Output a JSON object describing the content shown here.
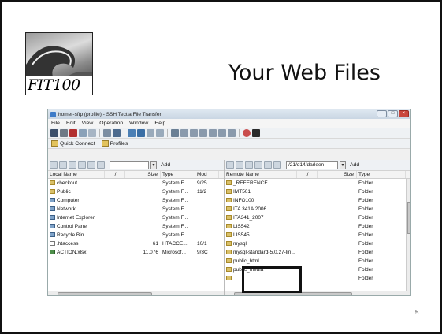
{
  "slide": {
    "title": "Your Web Files",
    "logo_text": "FIT100",
    "page_number": "5"
  },
  "window": {
    "title": "homer-sftp (profile) - SSH Tectia File Transfer",
    "menu": [
      "File",
      "Edit",
      "View",
      "Operation",
      "Window",
      "Help"
    ],
    "quick_connect": "Quick Connect",
    "profiles": "Profiles"
  },
  "left_pane": {
    "path": "",
    "add_label": "Add",
    "columns": [
      "Local Name",
      "/",
      "Size",
      "Type",
      "Mod"
    ],
    "rows": [
      {
        "name": "checkout",
        "size": "",
        "type": "System F...",
        "mod": "9/25",
        "icon": "folder-icon"
      },
      {
        "name": "Public",
        "size": "",
        "type": "System F...",
        "mod": "11/2",
        "icon": "folder-icon"
      },
      {
        "name": "Computer",
        "size": "",
        "type": "System F...",
        "mod": "",
        "icon": "computer-icon"
      },
      {
        "name": "Network",
        "size": "",
        "type": "System F...",
        "mod": "",
        "icon": "network-icon"
      },
      {
        "name": "Internet Explorer",
        "size": "",
        "type": "System F...",
        "mod": "",
        "icon": "browser-icon"
      },
      {
        "name": "Control Panel",
        "size": "",
        "type": "System F...",
        "mod": "",
        "icon": "control-panel-icon"
      },
      {
        "name": "Recycle Bin",
        "size": "",
        "type": "System F...",
        "mod": "",
        "icon": "recycle-bin-icon"
      },
      {
        "name": ".htaccess",
        "size": "61",
        "type": "HTACCE...",
        "mod": "10/1",
        "icon": "file-icon"
      },
      {
        "name": "ACTION.xlsx",
        "size": "11,076",
        "type": "Microsof...",
        "mod": "9/3C",
        "icon": "spreadsheet-icon"
      }
    ]
  },
  "right_pane": {
    "path": "/21/d14/darleen",
    "add_label": "Add",
    "columns": [
      "Remote Name",
      "/",
      "Size",
      "Type"
    ],
    "rows": [
      {
        "name": "_REFERENCE",
        "type": "Folder"
      },
      {
        "name": "IMT501",
        "type": "Folder"
      },
      {
        "name": "INFO100",
        "type": "Folder"
      },
      {
        "name": "ITA 341A 2006",
        "type": "Folder"
      },
      {
        "name": "ITA341_2007",
        "type": "Folder"
      },
      {
        "name": "LIS542",
        "type": "Folder"
      },
      {
        "name": "LIS545",
        "type": "Folder"
      },
      {
        "name": "mysql",
        "type": "Folder"
      },
      {
        "name": "mysql-standard-5.0.27-lin...",
        "type": "Folder"
      },
      {
        "name": "public_html",
        "type": "Folder"
      },
      {
        "name": "public_media",
        "type": "Folder"
      },
      {
        "name": "",
        "type": "Folder"
      }
    ]
  },
  "colors": {
    "titlebar": "#c9d6e3",
    "close_button": "#c9463d",
    "folder": "#d9c06a"
  }
}
